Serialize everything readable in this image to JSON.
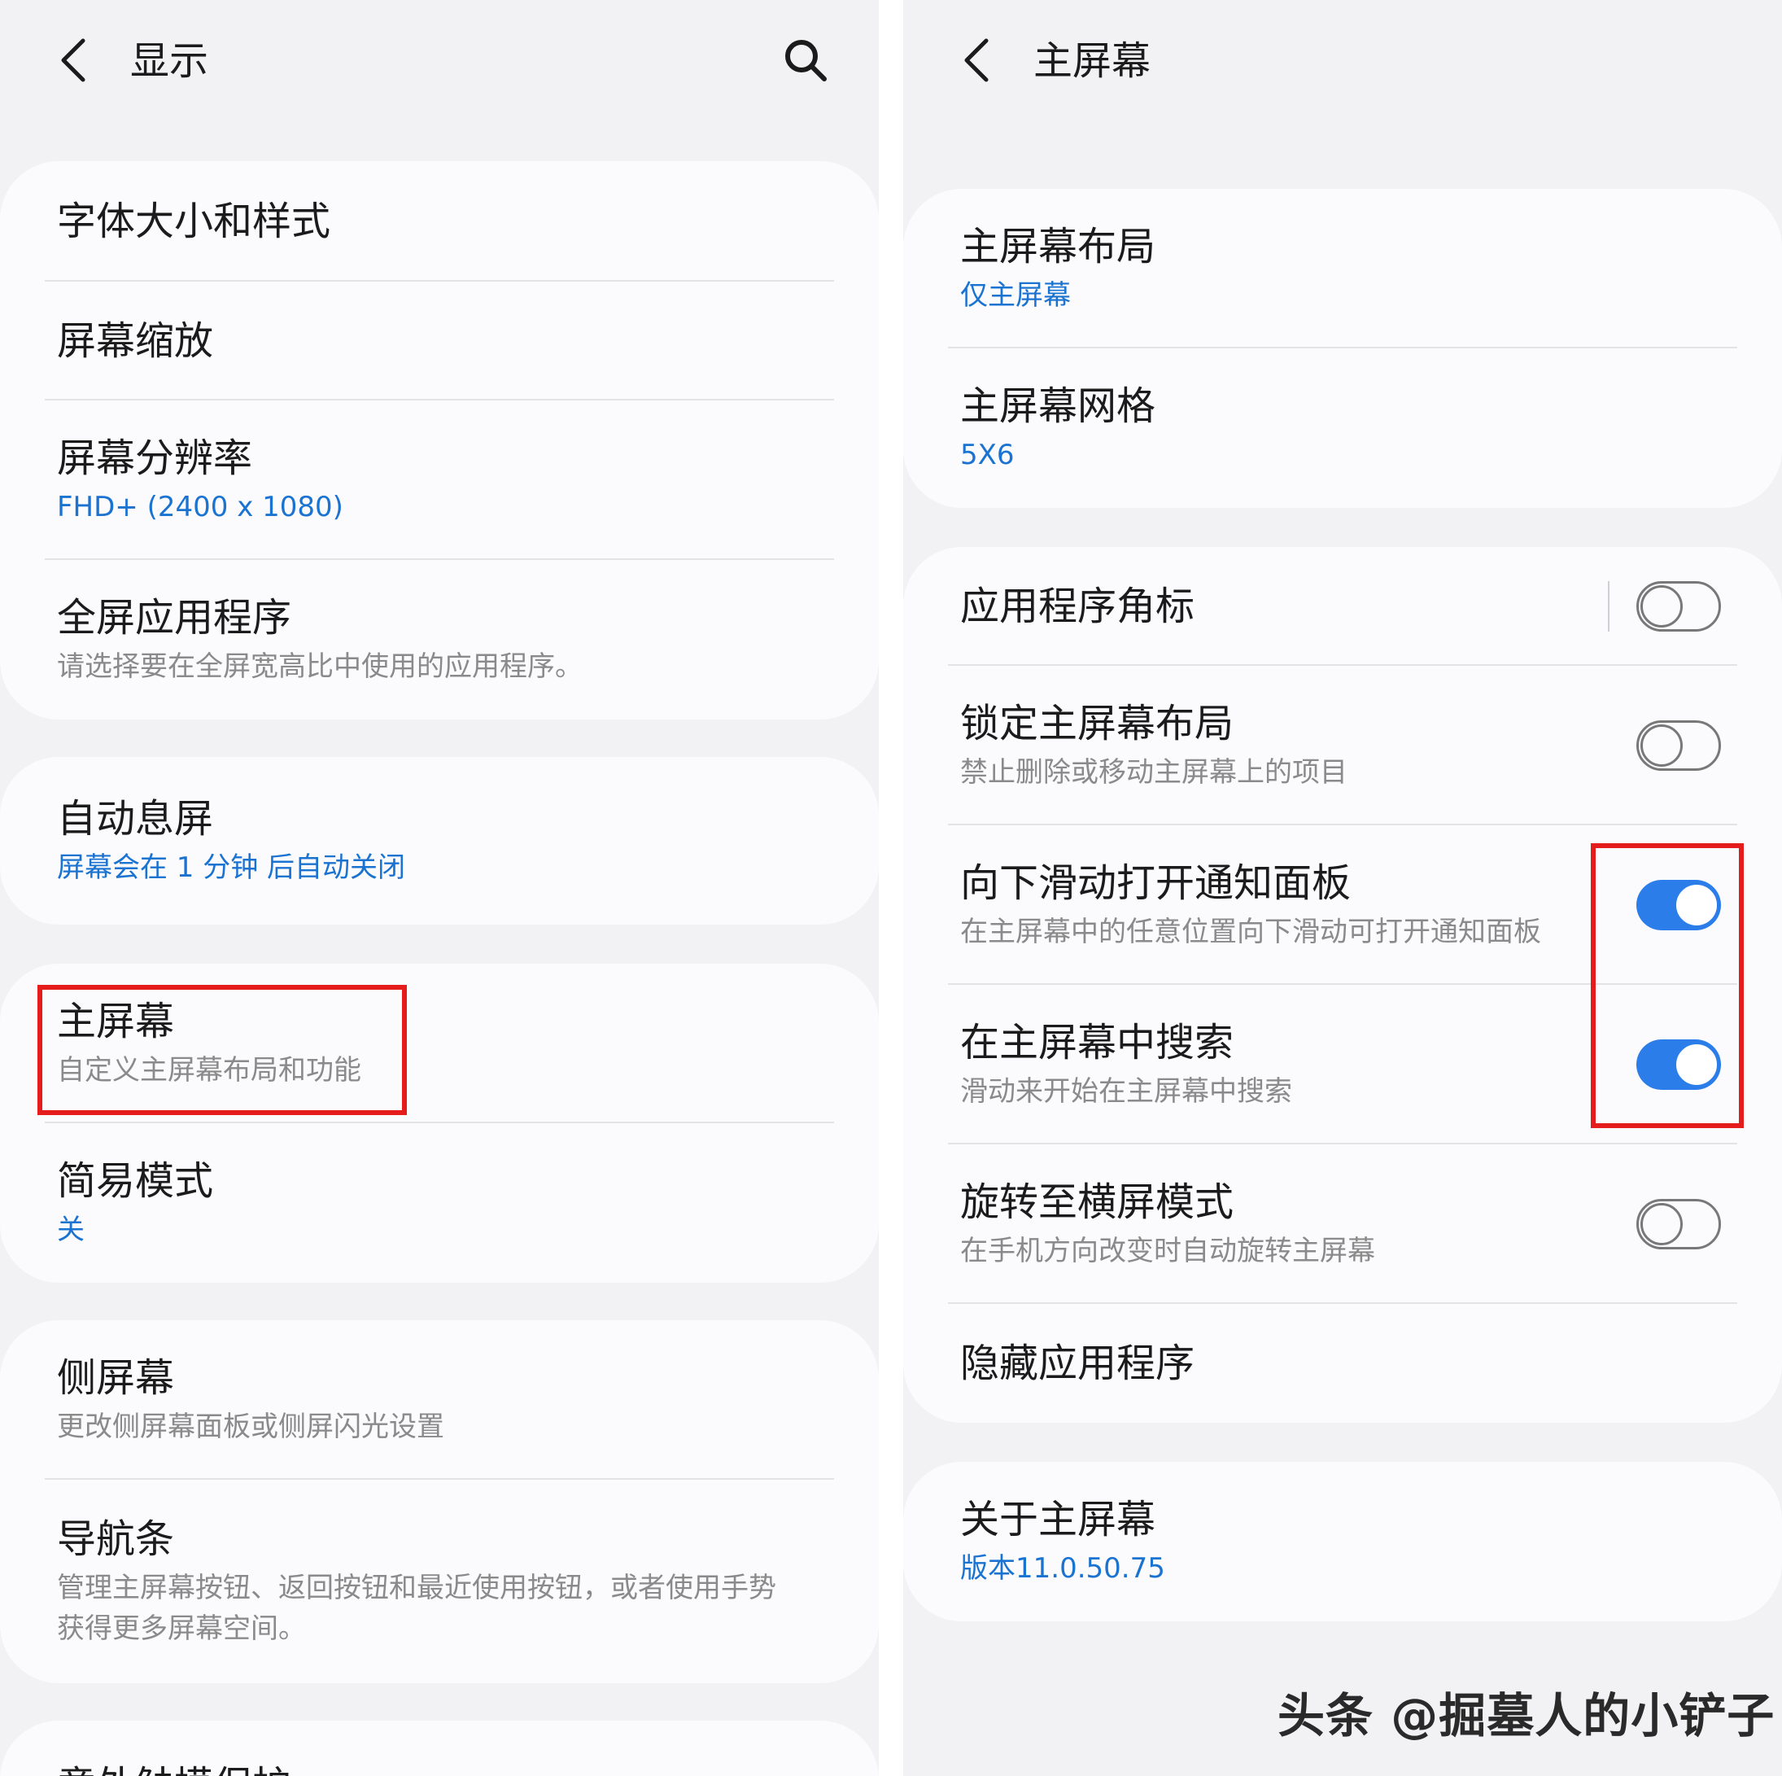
{
  "left": {
    "title": "显示",
    "groups": [
      [
        {
          "title": "字体大小和样式"
        },
        {
          "title": "屏幕缩放"
        },
        {
          "title": "屏幕分辨率",
          "subtitle": "FHD+ (2400 x 1080)",
          "subtitle_style": "blue"
        },
        {
          "title": "全屏应用程序",
          "subtitle": "请选择要在全屏宽高比中使用的应用程序。",
          "subtitle_style": "gray"
        }
      ],
      [
        {
          "title": "自动息屏",
          "subtitle": "屏幕会在 1 分钟 后自动关闭",
          "subtitle_style": "blue"
        }
      ],
      [
        {
          "title": "主屏幕",
          "subtitle": "自定义主屏幕布局和功能",
          "subtitle_style": "gray"
        },
        {
          "title": "简易模式",
          "subtitle": "关",
          "subtitle_style": "blue"
        }
      ],
      [
        {
          "title": "侧屏幕",
          "subtitle": "更改侧屏幕面板或侧屏闪光设置",
          "subtitle_style": "gray"
        },
        {
          "title": "导航条",
          "subtitle": "管理主屏幕按钮、返回按钮和最近使用按钮，或者使用手势获得更多屏幕空间。",
          "subtitle_style": "gray"
        }
      ],
      [
        {
          "title": "意外触摸保护"
        }
      ]
    ]
  },
  "right": {
    "title": "主屏幕",
    "groups": [
      [
        {
          "title": "主屏幕布局",
          "subtitle": "仅主屏幕",
          "subtitle_style": "blue"
        },
        {
          "title": "主屏幕网格",
          "subtitle": "5X6",
          "subtitle_style": "blue"
        }
      ],
      [
        {
          "title": "应用程序角标",
          "toggle": "off"
        },
        {
          "title": "锁定主屏幕布局",
          "subtitle": "禁止删除或移动主屏幕上的项目",
          "subtitle_style": "gray",
          "toggle": "off"
        },
        {
          "title": "向下滑动打开通知面板",
          "subtitle": "在主屏幕中的任意位置向下滑动可打开通知面板",
          "subtitle_style": "gray",
          "toggle": "on"
        },
        {
          "title": "在主屏幕中搜索",
          "subtitle": "滑动来开始在主屏幕中搜索",
          "subtitle_style": "gray",
          "toggle": "on"
        },
        {
          "title": "旋转至横屏模式",
          "subtitle": "在手机方向改变时自动旋转主屏幕",
          "subtitle_style": "gray",
          "toggle": "off"
        },
        {
          "title": "隐藏应用程序"
        }
      ],
      [
        {
          "title": "关于主屏幕",
          "subtitle": "版本11.0.50.75",
          "subtitle_style": "blue"
        }
      ]
    ]
  },
  "watermark": "头条 @掘墓人的小铲子",
  "colors": {
    "accent": "#2b7de9",
    "link_text": "#1b73d1",
    "highlight": "#e41c1c",
    "background": "#f2f2f4",
    "card": "#fbfbfd"
  },
  "icons": {
    "back": "chevron-left-icon",
    "search": "search-icon"
  }
}
